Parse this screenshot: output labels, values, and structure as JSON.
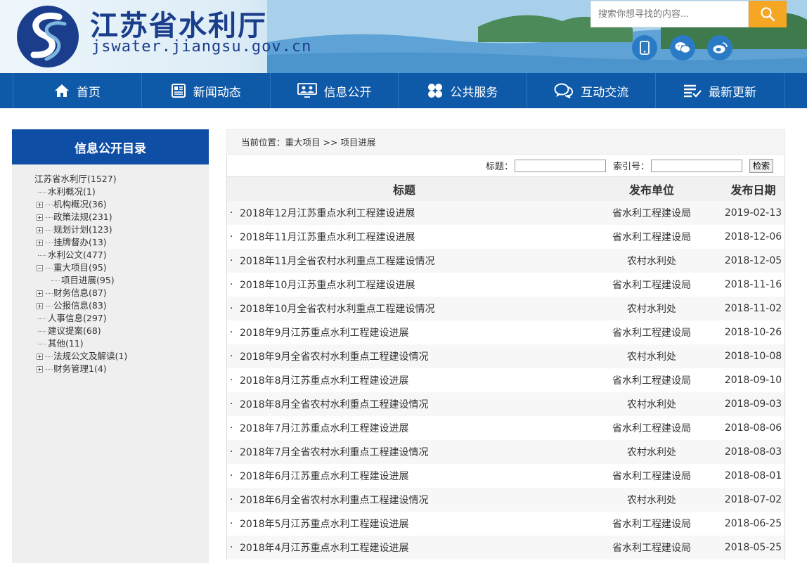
{
  "header": {
    "site_name": "江苏省水利厅",
    "domain": "jswater.jiangsu.gov.cn",
    "search_placeholder": "搜索你想寻找的内容..."
  },
  "nav": {
    "items": [
      {
        "label": "首页",
        "icon": "home-icon"
      },
      {
        "label": "新闻动态",
        "icon": "news-icon"
      },
      {
        "label": "信息公开",
        "icon": "info-icon"
      },
      {
        "label": "公共服务",
        "icon": "service-icon"
      },
      {
        "label": "互动交流",
        "icon": "chat-icon"
      },
      {
        "label": "最新更新",
        "icon": "update-icon"
      }
    ]
  },
  "sidebar": {
    "title": "信息公开目录",
    "tree": [
      {
        "label": "江苏省水利厅(1527)",
        "level": 0,
        "type": "root"
      },
      {
        "label": "水利概况(1)",
        "level": 1,
        "type": "leaf"
      },
      {
        "label": "机构概况(36)",
        "level": 1,
        "type": "plus"
      },
      {
        "label": "政策法规(231)",
        "level": 1,
        "type": "plus"
      },
      {
        "label": "规划计划(123)",
        "level": 1,
        "type": "plus"
      },
      {
        "label": "挂牌督办(13)",
        "level": 1,
        "type": "plus"
      },
      {
        "label": "水利公文(477)",
        "level": 1,
        "type": "leaf"
      },
      {
        "label": "重大项目(95)",
        "level": 1,
        "type": "minus"
      },
      {
        "label": "项目进展(95)",
        "level": 2,
        "type": "leaf"
      },
      {
        "label": "财务信息(87)",
        "level": 1,
        "type": "plus"
      },
      {
        "label": "公报信息(83)",
        "level": 1,
        "type": "plus"
      },
      {
        "label": "人事信息(297)",
        "level": 1,
        "type": "leaf"
      },
      {
        "label": "建议提案(68)",
        "level": 1,
        "type": "leaf"
      },
      {
        "label": "其他(11)",
        "level": 1,
        "type": "leaf"
      },
      {
        "label": "法规公文及解读(1)",
        "level": 1,
        "type": "plus"
      },
      {
        "label": "财务管理1(4)",
        "level": 1,
        "type": "plus"
      }
    ]
  },
  "breadcrumb": "当前位置：重大项目 >> 项目进展",
  "filter": {
    "title_label": "标题：",
    "index_label": "索引号：",
    "search_button": "检索"
  },
  "table": {
    "headers": {
      "title": "标题",
      "unit": "发布单位",
      "date": "发布日期"
    },
    "rows": [
      {
        "title": "2018年12月江苏重点水利工程建设进展",
        "unit": "省水利工程建设局",
        "date": "2019-02-13"
      },
      {
        "title": "2018年11月江苏重点水利工程建设进展",
        "unit": "省水利工程建设局",
        "date": "2018-12-06"
      },
      {
        "title": "2018年11月全省农村水利重点工程建设情况",
        "unit": "农村水利处",
        "date": "2018-12-05"
      },
      {
        "title": "2018年10月江苏重点水利工程建设进展",
        "unit": "省水利工程建设局",
        "date": "2018-11-16"
      },
      {
        "title": "2018年10月全省农村水利重点工程建设情况",
        "unit": "农村水利处",
        "date": "2018-11-02"
      },
      {
        "title": "2018年9月江苏重点水利工程建设进展",
        "unit": "省水利工程建设局",
        "date": "2018-10-26"
      },
      {
        "title": "2018年9月全省农村水利重点工程建设情况",
        "unit": "农村水利处",
        "date": "2018-10-08"
      },
      {
        "title": "2018年8月江苏重点水利工程建设进展",
        "unit": "省水利工程建设局",
        "date": "2018-09-10"
      },
      {
        "title": "2018年8月全省农村水利重点工程建设情况",
        "unit": "农村水利处",
        "date": "2018-09-03"
      },
      {
        "title": "2018年7月江苏重点水利工程建设进展",
        "unit": "省水利工程建设局",
        "date": "2018-08-06"
      },
      {
        "title": "2018年7月全省农村水利重点工程建设情况",
        "unit": "农村水利处",
        "date": "2018-08-03"
      },
      {
        "title": "2018年6月江苏重点水利工程建设进展",
        "unit": "省水利工程建设局",
        "date": "2018-08-01"
      },
      {
        "title": "2018年6月全省农村水利重点工程建设情况",
        "unit": "农村水利处",
        "date": "2018-07-02"
      },
      {
        "title": "2018年5月江苏重点水利工程建设进展",
        "unit": "省水利工程建设局",
        "date": "2018-06-25"
      },
      {
        "title": "2018年4月江苏重点水利工程建设进展",
        "unit": "省水利工程建设局",
        "date": "2018-05-25"
      }
    ]
  },
  "colors": {
    "nav_bg": "#0f5aa8",
    "sidebar_title_bg": "#0f4ea5",
    "search_button_bg": "#f5a623",
    "brand_text": "#1a3d8c"
  }
}
